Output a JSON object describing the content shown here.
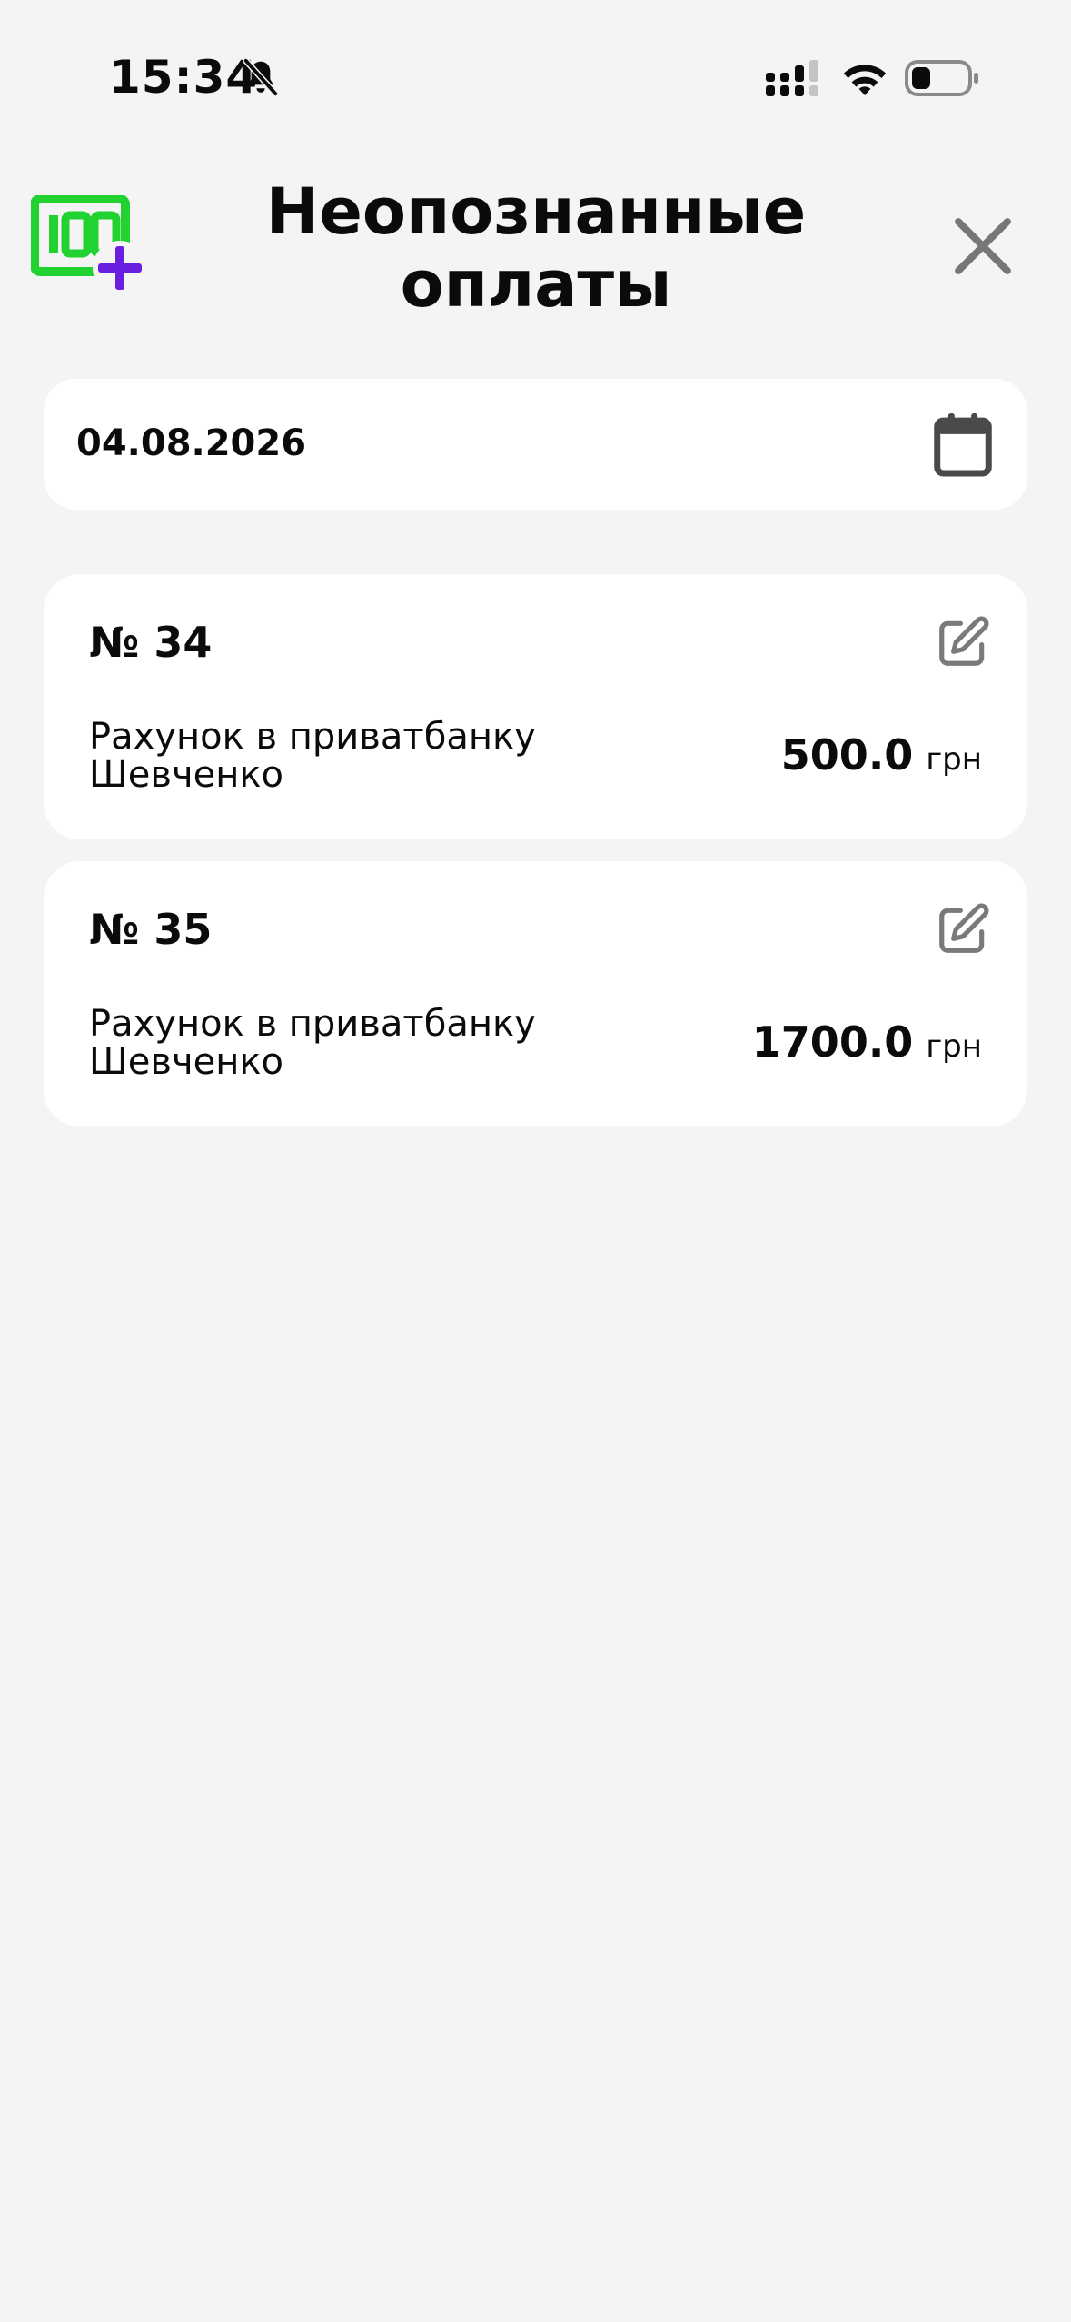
{
  "status_bar": {
    "time": "15:34",
    "icons": [
      "bell-muted-icon",
      "signal-icon",
      "wifi-icon",
      "battery-icon"
    ]
  },
  "header": {
    "title_line1": "Неопознанные",
    "title_line2": "оплаты",
    "logo_text": "100",
    "logo_color": "#22d230",
    "logo_plus_color": "#6a1fe0",
    "close_icon": "close-icon"
  },
  "date_filter": {
    "value": "04.08.2026",
    "icon": "calendar-icon"
  },
  "payments": [
    {
      "number": "№ 34",
      "description": "Рахунок в приватбанку Шевченко",
      "amount": "500.0",
      "currency": "грн"
    },
    {
      "number": "№ 35",
      "description": "Рахунок в приватбанку Шевченко",
      "amount": "1700.0",
      "currency": "грн"
    }
  ]
}
